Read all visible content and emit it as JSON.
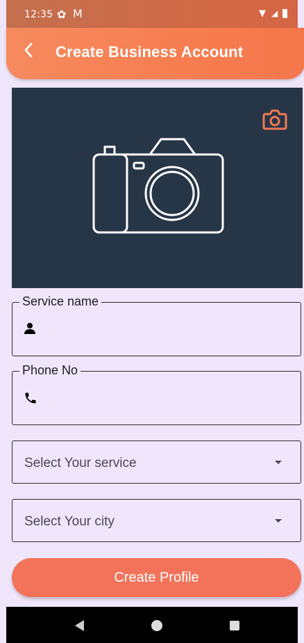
{
  "status_bar": {
    "time": "12:35",
    "icons": [
      "gear-icon",
      "gmail-icon",
      "wifi-icon",
      "signal-icon",
      "battery-icon"
    ]
  },
  "app_bar": {
    "back_icon": "back-arrow-icon",
    "title": "Create Business Account"
  },
  "photo_area": {
    "background": "#273647",
    "change_photo_icon": "camera-icon",
    "placeholder_icon": "camera-icon",
    "accent": "#f3784f"
  },
  "form": {
    "service_name": {
      "label": "Service name",
      "icon": "person-icon",
      "value": ""
    },
    "phone": {
      "label": "Phone No",
      "icon": "phone-icon",
      "value": ""
    },
    "service_select": {
      "placeholder": "Select Your service",
      "icon": "dropdown-caret-icon"
    },
    "city_select": {
      "placeholder": "Select Your city",
      "icon": "dropdown-caret-icon"
    }
  },
  "submit": {
    "label": "Create Profile",
    "color": "#f2735a"
  },
  "nav_bar": {
    "icons": [
      "back-icon",
      "home-icon",
      "recents-icon"
    ]
  }
}
